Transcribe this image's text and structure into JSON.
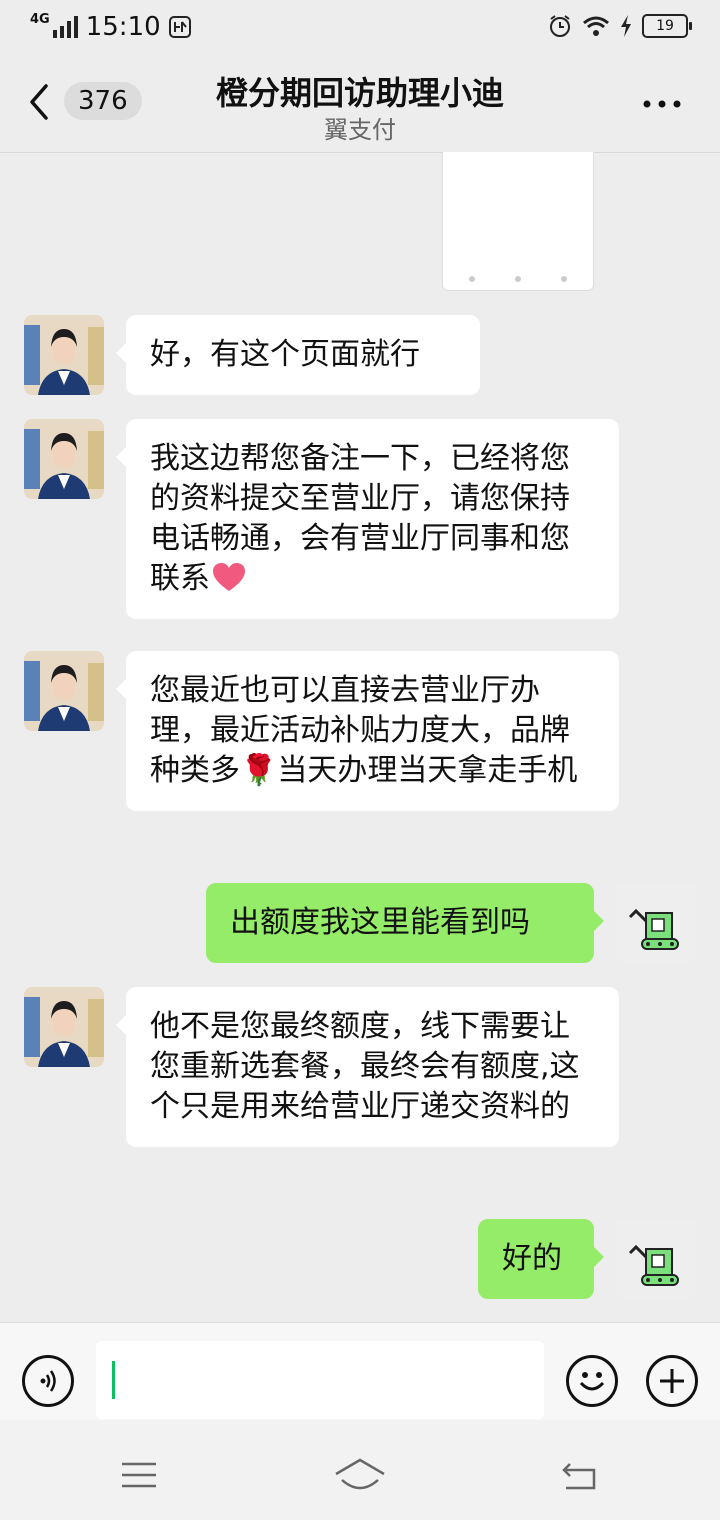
{
  "status_bar": {
    "network": "4G",
    "time": "15:10",
    "battery": "19"
  },
  "header": {
    "back_count": "376",
    "title": "橙分期回访助理小迪",
    "subtitle": "翼支付"
  },
  "messages": [
    {
      "side": "left",
      "text": "好，有这个页面就行"
    },
    {
      "side": "left",
      "text": "我这边帮您备注一下，已经将您的资料提交至营业厅，请您保持电话畅通，会有营业厅同事和您联系"
    },
    {
      "side": "left",
      "text": "您最近也可以直接去营业厅办理，最近活动补贴力度大，品牌种类多🌹当天办理当天拿走手机"
    },
    {
      "side": "right",
      "text": "出额度我这里能看到吗"
    },
    {
      "side": "left",
      "text": "他不是您最终额度，线下需要让您重新选套餐，最终会有额度,这个只是用来给营业厅递交资料的"
    },
    {
      "side": "right",
      "text": "好的"
    }
  ],
  "input": {
    "value": ""
  },
  "colors": {
    "background": "#ededed",
    "outgoing_bubble": "#95ec69",
    "incoming_bubble": "#ffffff",
    "caret": "#07c160"
  }
}
